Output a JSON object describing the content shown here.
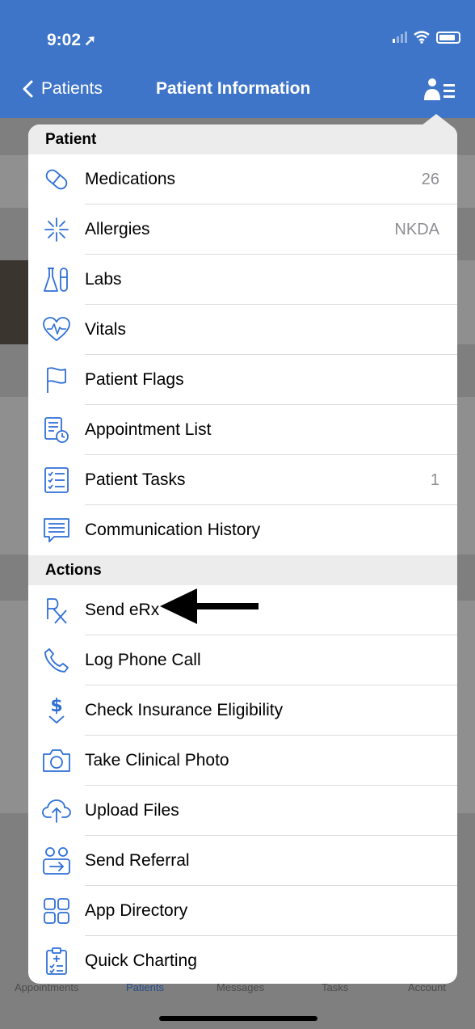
{
  "status_bar": {
    "time": "9:02"
  },
  "nav": {
    "back_label": "Patients",
    "title": "Patient Information"
  },
  "menu": {
    "sections": [
      {
        "title": "Patient",
        "items": [
          {
            "label": "Medications",
            "value": "26",
            "icon": "pill-icon"
          },
          {
            "label": "Allergies",
            "value": "NKDA",
            "icon": "allergy-icon"
          },
          {
            "label": "Labs",
            "value": "",
            "icon": "lab-flask-icon"
          },
          {
            "label": "Vitals",
            "value": "",
            "icon": "heart-pulse-icon"
          },
          {
            "label": "Patient Flags",
            "value": "",
            "icon": "flag-icon"
          },
          {
            "label": "Appointment List",
            "value": "",
            "icon": "appointment-list-icon"
          },
          {
            "label": "Patient Tasks",
            "value": "1",
            "icon": "checklist-icon"
          },
          {
            "label": "Communication History",
            "value": "",
            "icon": "chat-icon"
          }
        ]
      },
      {
        "title": "Actions",
        "items": [
          {
            "label": "Send eRx",
            "icon": "rx-icon"
          },
          {
            "label": "Log Phone Call",
            "icon": "phone-icon"
          },
          {
            "label": "Check Insurance Eligibility",
            "icon": "dollar-check-icon"
          },
          {
            "label": "Take Clinical Photo",
            "icon": "camera-icon"
          },
          {
            "label": "Upload Files",
            "icon": "cloud-upload-icon"
          },
          {
            "label": "Send Referral",
            "icon": "referral-icon"
          },
          {
            "label": "App Directory",
            "icon": "app-grid-icon"
          },
          {
            "label": "Quick Charting",
            "icon": "clipboard-icon"
          }
        ]
      }
    ]
  },
  "tabbar": {
    "items": [
      "Appointments",
      "Patients",
      "Messages",
      "Tasks",
      "Account"
    ],
    "active": "Patients"
  },
  "colors": {
    "header_bg": "#3f75c8",
    "accent": "#2f6fd6",
    "section_bg": "#ececec"
  }
}
